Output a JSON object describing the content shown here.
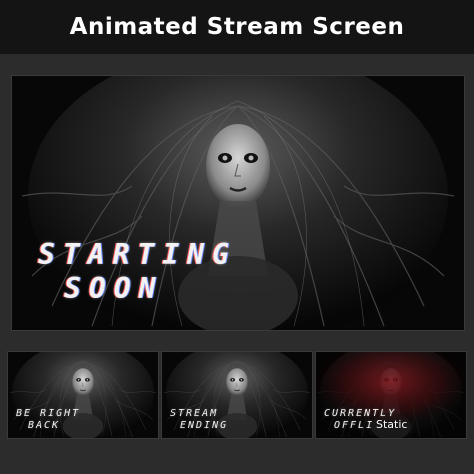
{
  "header": {
    "title": "Animated Stream Screen"
  },
  "main_screen": {
    "line1": "STARTING",
    "line2": "SOON"
  },
  "thumbnails": [
    {
      "line1": "BE RIGHT",
      "line2": "BACK"
    },
    {
      "line1": "STREAM",
      "line2": "ENDING"
    },
    {
      "line1": "CURRENTLY",
      "line2": "OFFLI",
      "overlay": "Static"
    }
  ],
  "colors": {
    "background": "#2c2c2c",
    "header_background": "#141414",
    "header_text": "#ffffff",
    "accent_red": "#c0141e"
  }
}
